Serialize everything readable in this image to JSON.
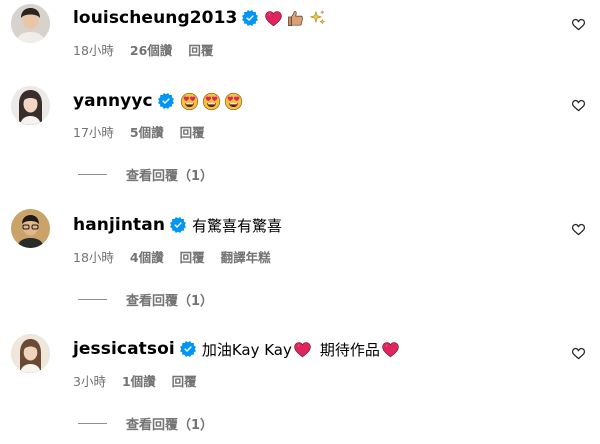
{
  "comments": [
    {
      "username": "louischeung2013",
      "text": "",
      "emojis": [
        "red-heart-emoji",
        "thumbs-up-emoji",
        "sparkles-emoji"
      ],
      "time": "18小時",
      "likes": "26個讚",
      "reply_label": "回覆"
    },
    {
      "username": "yannyyc",
      "text": "",
      "emojis": [
        "heart-eyes-emoji",
        "heart-eyes-emoji",
        "heart-eyes-emoji"
      ],
      "time": "17小時",
      "likes": "5個讚",
      "reply_label": "回覆",
      "view_replies": "查看回覆（1）"
    },
    {
      "username": "hanjintan",
      "text": "有驚喜有驚喜",
      "time": "18小時",
      "likes": "4個讚",
      "reply_label": "回覆",
      "translate_label": "翻譯年糕",
      "view_replies": "查看回覆（1）"
    },
    {
      "username": "jessicatsoi",
      "text_part1": "加油Kay Kay",
      "text_part2": "期待作品",
      "emojis": [
        "red-heart-emoji",
        "red-heart-emoji"
      ],
      "time": "3小時",
      "likes": "1個讚",
      "reply_label": "回覆",
      "view_replies": "查看回覆（1）"
    }
  ],
  "colors": {
    "verified": "#0095f6",
    "meta": "#737373",
    "heart_emoji": "#e0245e"
  }
}
